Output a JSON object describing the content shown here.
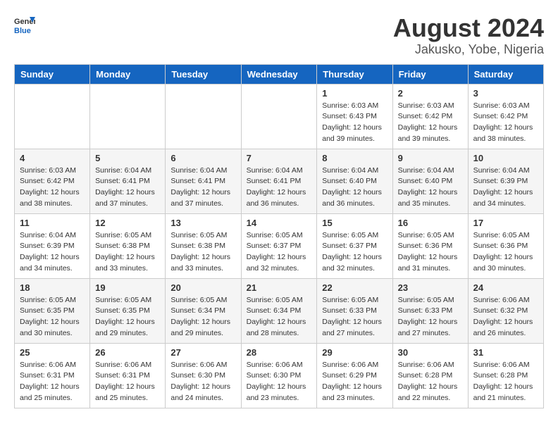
{
  "logo": {
    "line1": "General",
    "line2": "Blue"
  },
  "title": "August 2024",
  "subtitle": "Jakusko, Yobe, Nigeria",
  "weekdays": [
    "Sunday",
    "Monday",
    "Tuesday",
    "Wednesday",
    "Thursday",
    "Friday",
    "Saturday"
  ],
  "weeks": [
    [
      {
        "day": "",
        "info": ""
      },
      {
        "day": "",
        "info": ""
      },
      {
        "day": "",
        "info": ""
      },
      {
        "day": "",
        "info": ""
      },
      {
        "day": "1",
        "info": "Sunrise: 6:03 AM\nSunset: 6:43 PM\nDaylight: 12 hours\nand 39 minutes."
      },
      {
        "day": "2",
        "info": "Sunrise: 6:03 AM\nSunset: 6:42 PM\nDaylight: 12 hours\nand 39 minutes."
      },
      {
        "day": "3",
        "info": "Sunrise: 6:03 AM\nSunset: 6:42 PM\nDaylight: 12 hours\nand 38 minutes."
      }
    ],
    [
      {
        "day": "4",
        "info": "Sunrise: 6:03 AM\nSunset: 6:42 PM\nDaylight: 12 hours\nand 38 minutes."
      },
      {
        "day": "5",
        "info": "Sunrise: 6:04 AM\nSunset: 6:41 PM\nDaylight: 12 hours\nand 37 minutes."
      },
      {
        "day": "6",
        "info": "Sunrise: 6:04 AM\nSunset: 6:41 PM\nDaylight: 12 hours\nand 37 minutes."
      },
      {
        "day": "7",
        "info": "Sunrise: 6:04 AM\nSunset: 6:41 PM\nDaylight: 12 hours\nand 36 minutes."
      },
      {
        "day": "8",
        "info": "Sunrise: 6:04 AM\nSunset: 6:40 PM\nDaylight: 12 hours\nand 36 minutes."
      },
      {
        "day": "9",
        "info": "Sunrise: 6:04 AM\nSunset: 6:40 PM\nDaylight: 12 hours\nand 35 minutes."
      },
      {
        "day": "10",
        "info": "Sunrise: 6:04 AM\nSunset: 6:39 PM\nDaylight: 12 hours\nand 34 minutes."
      }
    ],
    [
      {
        "day": "11",
        "info": "Sunrise: 6:04 AM\nSunset: 6:39 PM\nDaylight: 12 hours\nand 34 minutes."
      },
      {
        "day": "12",
        "info": "Sunrise: 6:05 AM\nSunset: 6:38 PM\nDaylight: 12 hours\nand 33 minutes."
      },
      {
        "day": "13",
        "info": "Sunrise: 6:05 AM\nSunset: 6:38 PM\nDaylight: 12 hours\nand 33 minutes."
      },
      {
        "day": "14",
        "info": "Sunrise: 6:05 AM\nSunset: 6:37 PM\nDaylight: 12 hours\nand 32 minutes."
      },
      {
        "day": "15",
        "info": "Sunrise: 6:05 AM\nSunset: 6:37 PM\nDaylight: 12 hours\nand 32 minutes."
      },
      {
        "day": "16",
        "info": "Sunrise: 6:05 AM\nSunset: 6:36 PM\nDaylight: 12 hours\nand 31 minutes."
      },
      {
        "day": "17",
        "info": "Sunrise: 6:05 AM\nSunset: 6:36 PM\nDaylight: 12 hours\nand 30 minutes."
      }
    ],
    [
      {
        "day": "18",
        "info": "Sunrise: 6:05 AM\nSunset: 6:35 PM\nDaylight: 12 hours\nand 30 minutes."
      },
      {
        "day": "19",
        "info": "Sunrise: 6:05 AM\nSunset: 6:35 PM\nDaylight: 12 hours\nand 29 minutes."
      },
      {
        "day": "20",
        "info": "Sunrise: 6:05 AM\nSunset: 6:34 PM\nDaylight: 12 hours\nand 29 minutes."
      },
      {
        "day": "21",
        "info": "Sunrise: 6:05 AM\nSunset: 6:34 PM\nDaylight: 12 hours\nand 28 minutes."
      },
      {
        "day": "22",
        "info": "Sunrise: 6:05 AM\nSunset: 6:33 PM\nDaylight: 12 hours\nand 27 minutes."
      },
      {
        "day": "23",
        "info": "Sunrise: 6:05 AM\nSunset: 6:33 PM\nDaylight: 12 hours\nand 27 minutes."
      },
      {
        "day": "24",
        "info": "Sunrise: 6:06 AM\nSunset: 6:32 PM\nDaylight: 12 hours\nand 26 minutes."
      }
    ],
    [
      {
        "day": "25",
        "info": "Sunrise: 6:06 AM\nSunset: 6:31 PM\nDaylight: 12 hours\nand 25 minutes."
      },
      {
        "day": "26",
        "info": "Sunrise: 6:06 AM\nSunset: 6:31 PM\nDaylight: 12 hours\nand 25 minutes."
      },
      {
        "day": "27",
        "info": "Sunrise: 6:06 AM\nSunset: 6:30 PM\nDaylight: 12 hours\nand 24 minutes."
      },
      {
        "day": "28",
        "info": "Sunrise: 6:06 AM\nSunset: 6:30 PM\nDaylight: 12 hours\nand 23 minutes."
      },
      {
        "day": "29",
        "info": "Sunrise: 6:06 AM\nSunset: 6:29 PM\nDaylight: 12 hours\nand 23 minutes."
      },
      {
        "day": "30",
        "info": "Sunrise: 6:06 AM\nSunset: 6:28 PM\nDaylight: 12 hours\nand 22 minutes."
      },
      {
        "day": "31",
        "info": "Sunrise: 6:06 AM\nSunset: 6:28 PM\nDaylight: 12 hours\nand 21 minutes."
      }
    ]
  ]
}
